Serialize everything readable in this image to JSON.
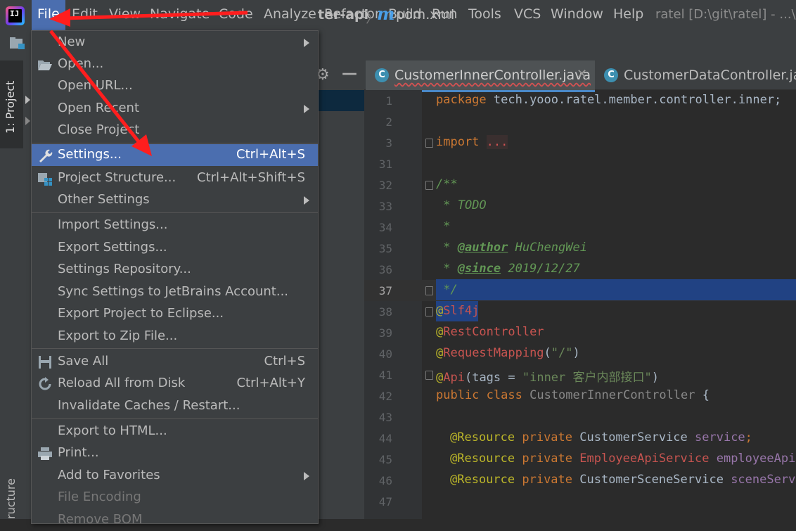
{
  "menubar": {
    "items": [
      {
        "label": "File",
        "left": 0
      },
      {
        "label": "Edit"
      },
      {
        "label": "View"
      },
      {
        "label": "Navigate"
      },
      {
        "label": "Code"
      },
      {
        "label": "Analyze"
      },
      {
        "label": "Refactor"
      },
      {
        "label": "Build"
      },
      {
        "label": "Run"
      },
      {
        "label": "Tools"
      },
      {
        "label": "VCS"
      },
      {
        "label": "Window"
      },
      {
        "label": "Help"
      }
    ],
    "window_title": "ratel [D:\\git\\ratel] - ...\\y"
  },
  "navbar": {
    "crumb_module": "ter-api",
    "crumb_file_icon": "m",
    "crumb_file": "pom.xml"
  },
  "tool_windows": {
    "project_tab": "1: Project",
    "structure_tab": "ructure"
  },
  "editor_tabs": [
    {
      "label": "CustomerInnerController.java",
      "icon": "C",
      "active": true
    },
    {
      "label": "CustomerDataController.java",
      "icon": "C",
      "active": false
    }
  ],
  "editor": {
    "lines": [
      {
        "num": "1"
      },
      {
        "num": "2"
      },
      {
        "num": "3"
      },
      {
        "num": "31"
      },
      {
        "num": "32"
      },
      {
        "num": "33"
      },
      {
        "num": "34"
      },
      {
        "num": "35"
      },
      {
        "num": "36"
      },
      {
        "num": "37"
      },
      {
        "num": "38"
      },
      {
        "num": "39"
      },
      {
        "num": "40"
      },
      {
        "num": "41"
      },
      {
        "num": "42"
      },
      {
        "num": "43"
      },
      {
        "num": "44"
      },
      {
        "num": "45"
      },
      {
        "num": "46"
      },
      {
        "num": "47"
      }
    ],
    "code": {
      "l1_kw": "package",
      "l1_rest": " tech.yooo.ratel.member.controller.inner;",
      "l3_kw": "import",
      "l3_dots": "...",
      "l32": "/**",
      "l33_star": " * ",
      "l33_todo": "TODO",
      "l34": " *",
      "l35_star": " * ",
      "l35_tag": "@author",
      "l35_val": " HuChengWei",
      "l36_star": " * ",
      "l36_tag": "@since",
      "l36_val": " 2019/12/27",
      "l37": " */",
      "l38_at": "@",
      "l38_name": "Slf4j",
      "l39_at": "@",
      "l39_name": "RestController",
      "l40_at": "@",
      "l40_name": "RequestMapping",
      "l40_open": "(",
      "l40_str": "\"/\"",
      "l40_close": ")",
      "l41_at": "@",
      "l41_name": "Api",
      "l41_open": "(tags = ",
      "l41_str": "\"inner 客户内部接口\"",
      "l41_close": ")",
      "l42_kw1": "public",
      "l42_kw2": "class",
      "l42_name": "CustomerInnerController",
      "l42_brace": " {",
      "l44_ann": "@Resource",
      "l44_kw": " private ",
      "l44_type": "CustomerService",
      "l44_fld": " service",
      "l44_semi": ";",
      "l45_ann": "@Resource",
      "l45_kw": " private ",
      "l45_type": "EmployeeApiService",
      "l45_fld": " employeeApiSe",
      "l46_ann": "@Resource",
      "l46_kw": " private ",
      "l46_type": "CustomerSceneService",
      "l46_fld": " sceneServi"
    }
  },
  "file_menu": {
    "items": [
      {
        "label": "New",
        "shortcut": "",
        "submenu": true
      },
      {
        "label": "Open...",
        "shortcut": "",
        "icon": "folder-open-icon"
      },
      {
        "label": "Open URL...",
        "shortcut": ""
      },
      {
        "label": "Open Recent",
        "shortcut": "",
        "submenu": true
      },
      {
        "label": "Close Project",
        "shortcut": ""
      },
      {
        "label": "Settings...",
        "shortcut": "Ctrl+Alt+S",
        "icon": "wrench-icon",
        "selected": true
      },
      {
        "label": "Project Structure...",
        "shortcut": "Ctrl+Alt+Shift+S",
        "icon": "project-structure-icon"
      },
      {
        "label": "Other Settings",
        "shortcut": "",
        "submenu": true
      },
      {
        "label": "Import Settings...",
        "shortcut": ""
      },
      {
        "label": "Export Settings...",
        "shortcut": ""
      },
      {
        "label": "Settings Repository...",
        "shortcut": ""
      },
      {
        "label": "Sync Settings to JetBrains Account...",
        "shortcut": ""
      },
      {
        "label": "Export Project to Eclipse...",
        "shortcut": ""
      },
      {
        "label": "Export to Zip File...",
        "shortcut": ""
      },
      {
        "label": "Save All",
        "shortcut": "Ctrl+S",
        "icon": "save-icon"
      },
      {
        "label": "Reload All from Disk",
        "shortcut": "Ctrl+Alt+Y",
        "icon": "reload-icon"
      },
      {
        "label": "Invalidate Caches / Restart...",
        "shortcut": ""
      },
      {
        "label": "Export to HTML...",
        "shortcut": ""
      },
      {
        "label": "Print...",
        "shortcut": "",
        "icon": "print-icon"
      },
      {
        "label": "Add to Favorites",
        "shortcut": "",
        "submenu": true
      },
      {
        "label": "File Encoding",
        "shortcut": "",
        "disabled": true
      },
      {
        "label": "Remove BOM",
        "shortcut": "",
        "disabled": true
      }
    ]
  },
  "colors": {
    "menu_bg": "#3c3f41",
    "selection": "#4b6eaf",
    "editor_bg": "#2b2b2b",
    "annotation_arrow": "#ff1e1e"
  }
}
